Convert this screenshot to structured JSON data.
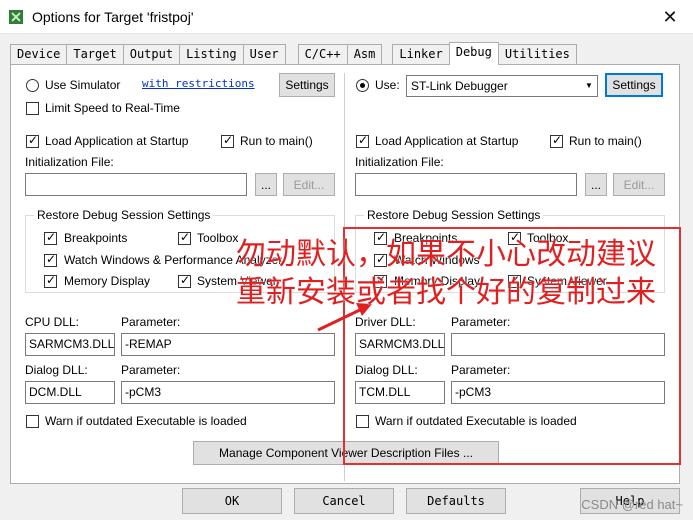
{
  "window": {
    "title": "Options for Target 'fristpoj'",
    "close_glyph": "✕"
  },
  "tabs": [
    {
      "label": "Device",
      "active": false
    },
    {
      "label": "Target",
      "active": false
    },
    {
      "label": "Output",
      "active": false
    },
    {
      "label": "Listing",
      "active": false
    },
    {
      "label": "User",
      "active": false
    },
    {
      "label": "C/C++",
      "active": false
    },
    {
      "label": "Asm",
      "active": false
    },
    {
      "label": "Linker",
      "active": false
    },
    {
      "label": "Debug",
      "active": true
    },
    {
      "label": "Utilities",
      "active": false
    }
  ],
  "left": {
    "use_simulator_label": "Use Simulator",
    "restrictions_link": "with restrictions",
    "settings_label": "Settings",
    "limit_speed_label": "Limit Speed to Real-Time",
    "load_app_label": "Load Application at Startup",
    "run_main_label": "Run to main()",
    "init_file_label": "Initialization File:",
    "browse_label": "...",
    "edit_label": "Edit...",
    "restore_title": "Restore Debug Session Settings",
    "breakpoints_label": "Breakpoints",
    "toolbox_label": "Toolbox",
    "watch_label": "Watch Windows & Performance Analyzer",
    "memory_label": "Memory Display",
    "sysviewer_label": "System Viewer",
    "cpu_dll_label": "CPU DLL:",
    "param_label": "Parameter:",
    "cpu_dll_value": "SARMCM3.DLL",
    "cpu_param_value": "-REMAP",
    "dialog_dll_label": "Dialog DLL:",
    "dialog_dll_value": "DCM.DLL",
    "dialog_param_value": "-pCM3",
    "warn_label": "Warn if outdated Executable is loaded",
    "manage_label": "Manage Component Viewer Description Files ..."
  },
  "right": {
    "use_label": "Use:",
    "debugger_value": "ST-Link Debugger",
    "settings_label": "Settings",
    "load_app_label": "Load Application at Startup",
    "run_main_label": "Run to main()",
    "init_file_label": "Initialization File:",
    "browse_label": "...",
    "edit_label": "Edit...",
    "restore_title": "Restore Debug Session Settings",
    "breakpoints_label": "Breakpoints",
    "toolbox_label": "Toolbox",
    "watch_label": "Watch Windows",
    "memory_label": "Memory Display",
    "sysviewer_label": "System Viewer",
    "driver_dll_label": "Driver DLL:",
    "param_label": "Parameter:",
    "driver_dll_value": "SARMCM3.DLL",
    "driver_param_value": "",
    "dialog_dll_label": "Dialog DLL:",
    "dialog_dll_value": "TCM.DLL",
    "dialog_param_value": "-pCM3",
    "warn_label": "Warn if outdated Executable is loaded"
  },
  "footer": {
    "ok_label": "OK",
    "cancel_label": "Cancel",
    "defaults_label": "Defaults",
    "help_label": "Help"
  },
  "annotation": {
    "text": "勿动默认，如果不小心改动建议重新安装或者找个好的复制过来",
    "color": "#e02020"
  },
  "watermark": "CSDN @red hat~"
}
